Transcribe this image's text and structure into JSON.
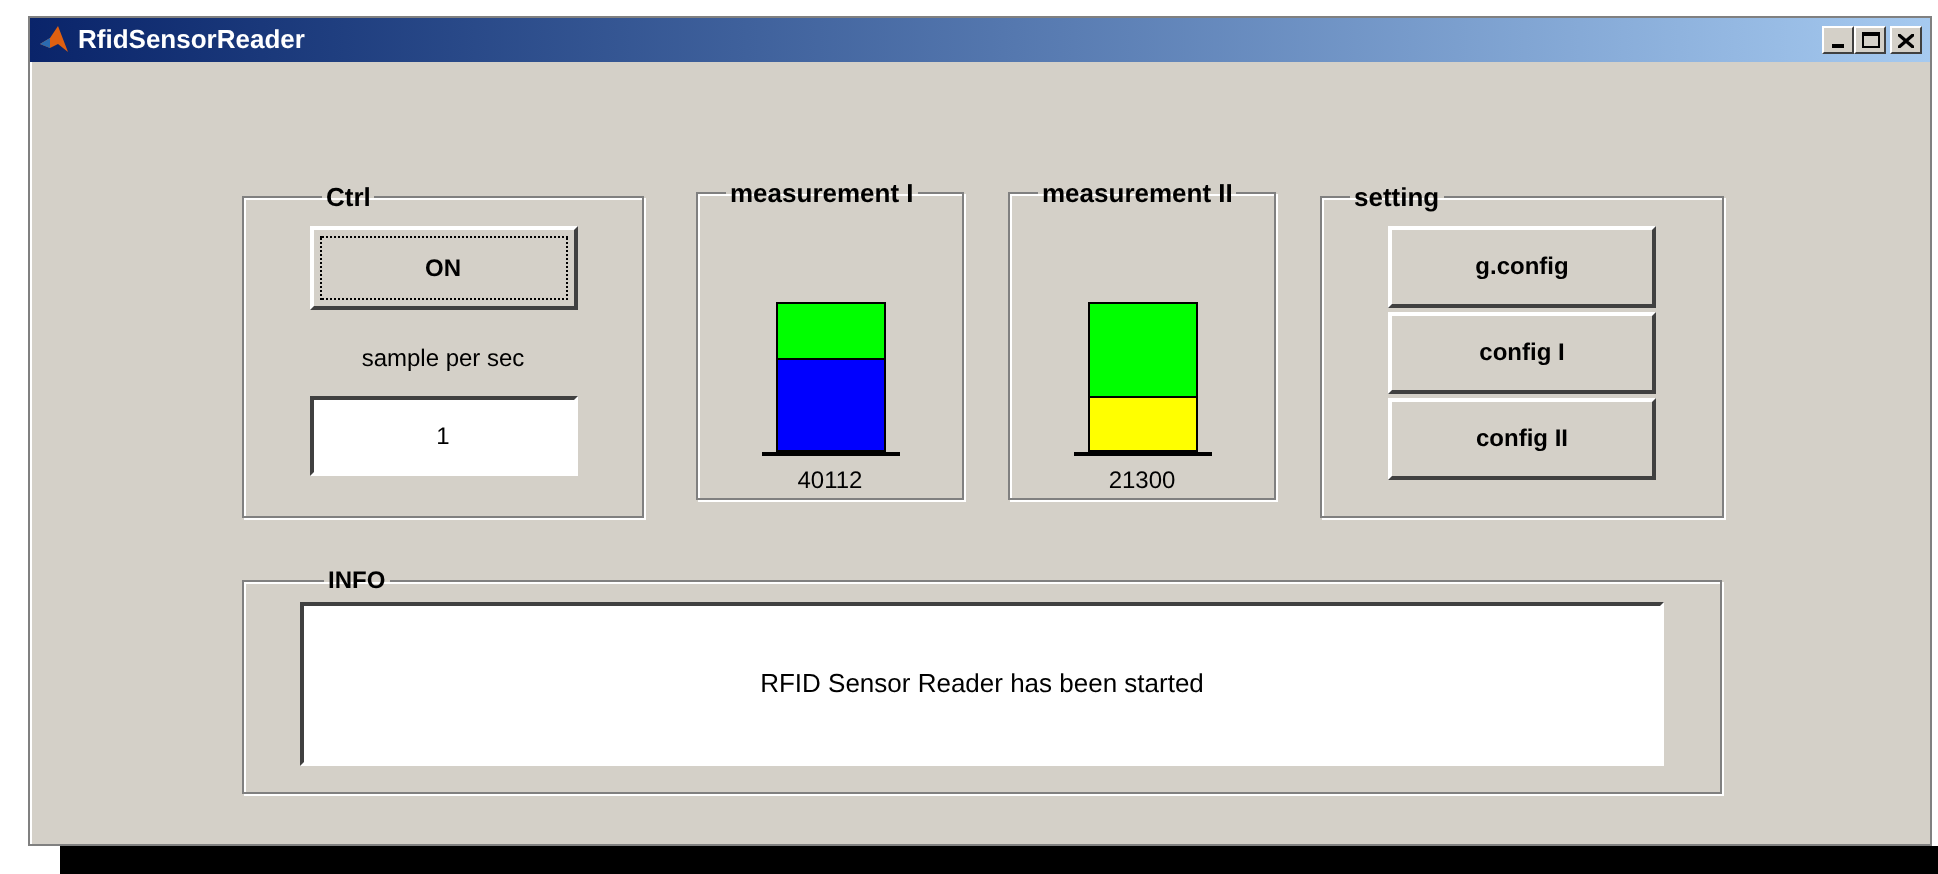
{
  "window": {
    "title": "RfidSensorReader"
  },
  "ctrl": {
    "title": "Ctrl",
    "button": "ON",
    "rate_label": "sample per sec",
    "rate_value": "1"
  },
  "measurements": [
    {
      "title": "measurement I",
      "level": 0.62,
      "color": "#0000ff",
      "reading": "40112"
    },
    {
      "title": "measurement II",
      "level": 0.36,
      "color": "#ffff00",
      "reading": "21300"
    }
  ],
  "setting": {
    "title": "setting",
    "buttons": [
      "g.config",
      "config I",
      "config II"
    ]
  },
  "info": {
    "title": "INFO",
    "message": "RFID Sensor Reader has been started"
  }
}
